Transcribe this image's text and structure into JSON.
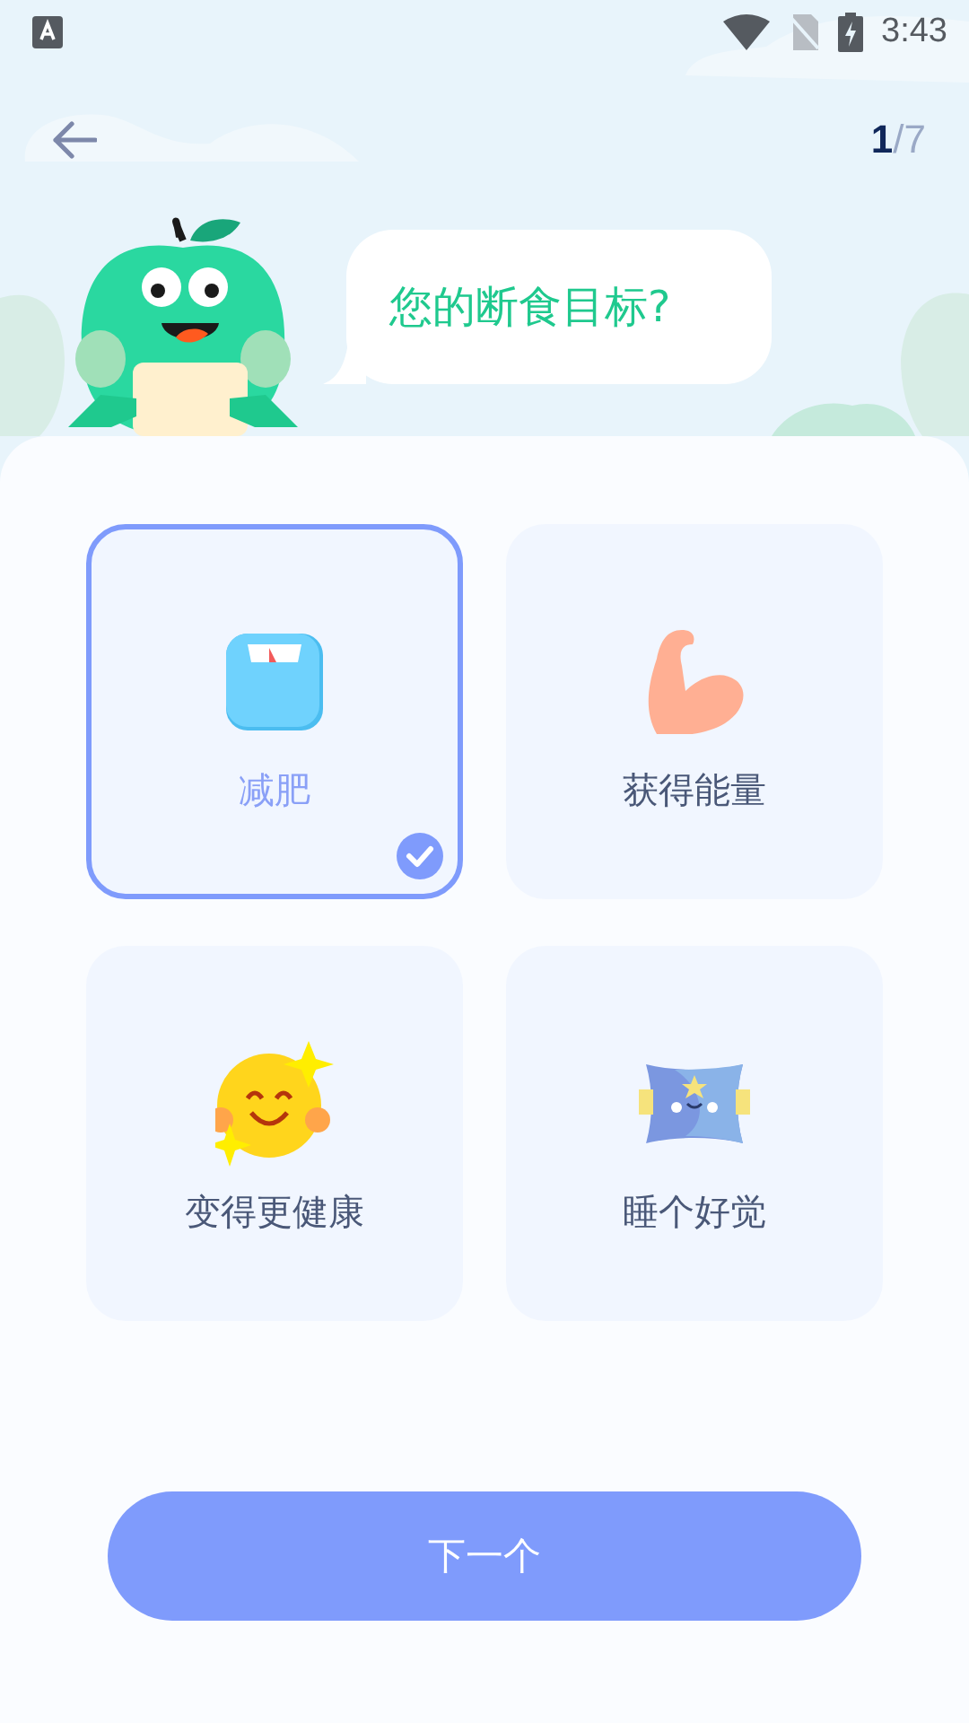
{
  "status_bar": {
    "time": "3:43"
  },
  "header": {
    "step_current": "1",
    "step_rest": "/7"
  },
  "speech_bubble": {
    "text": "您的断食目标?"
  },
  "options": [
    {
      "label": "减肥",
      "kind": "scale",
      "selected": true
    },
    {
      "label": "获得能量",
      "kind": "muscle",
      "selected": false
    },
    {
      "label": "变得更健康",
      "kind": "sun",
      "selected": false
    },
    {
      "label": "睡个好觉",
      "kind": "pillow",
      "selected": false
    }
  ],
  "next_button": {
    "label": "下一个"
  }
}
